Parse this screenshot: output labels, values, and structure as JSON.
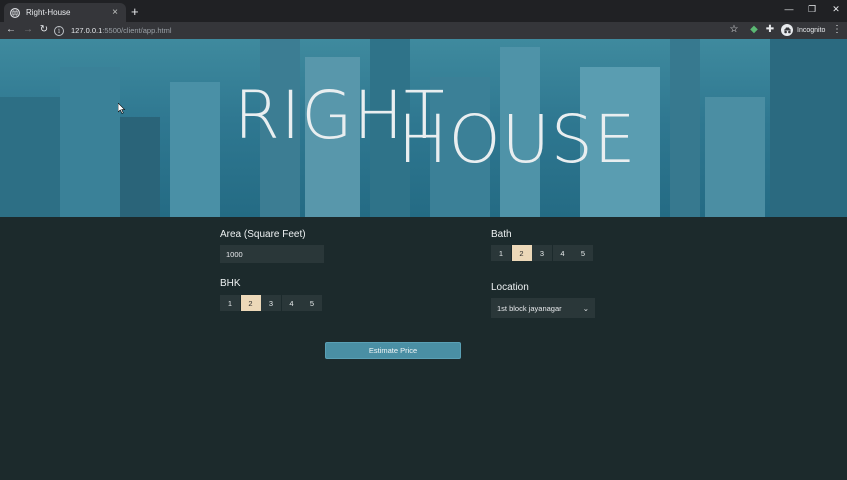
{
  "browser": {
    "tab_title": "Right-House",
    "tab_close": "×",
    "new_tab": "+",
    "url_host": "127.0.0.1",
    "url_path": ":5500/client/app.html",
    "profile_label": "Incognito",
    "icons": [
      "back-icon",
      "forward-icon",
      "reload-icon",
      "info-icon",
      "star-icon",
      "extension-icon",
      "puzzle-icon",
      "incognito-icon",
      "menu-icon",
      "minimize-icon",
      "restore-icon",
      "close-icon"
    ]
  },
  "hero": {
    "title_part1": "RIGHT",
    "title_part2": "HOUSE"
  },
  "form": {
    "area": {
      "label": "Area (Square Feet)",
      "value": "1000"
    },
    "bhk": {
      "label": "BHK",
      "options": [
        "1",
        "2",
        "3",
        "4",
        "5"
      ],
      "selected": "2"
    },
    "bath": {
      "label": "Bath",
      "options": [
        "1",
        "2",
        "3",
        "4",
        "5"
      ],
      "selected": "2"
    },
    "location": {
      "label": "Location",
      "value": "1st block jayanagar"
    },
    "submit_label": "Estimate Price"
  },
  "colors": {
    "page_bg": "#1c2a2c",
    "hero_tint": "#2f7891",
    "active_option": "#ecd8b8",
    "button": "#4a8fa4"
  }
}
